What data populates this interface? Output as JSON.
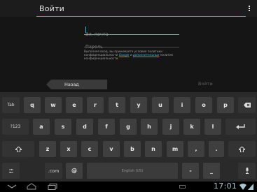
{
  "action_bar": {
    "title": "Войти"
  },
  "form": {
    "email_placeholder": "Эл. почта",
    "password_placeholder": "Пароль",
    "terms": {
      "part1": "Выполняя вход, вы принимаете условия политики конфиденциальности ",
      "link1": "Google",
      "part2": " и ",
      "link2": "дополнительных",
      "part3": " политик конфиденциальности."
    }
  },
  "nav": {
    "back_label": "Назад",
    "signin_label": "Войти"
  },
  "keyboard": {
    "row1": [
      "Tab",
      "q",
      "w",
      "e",
      "r",
      "t",
      "y",
      "u",
      "i",
      "o",
      "p"
    ],
    "row2": [
      "?123",
      "a",
      "s",
      "d",
      "f",
      "g",
      "h",
      "j",
      "k",
      "l"
    ],
    "row3": [
      "z",
      "x",
      "c",
      "v",
      "b",
      "n",
      "m",
      ",",
      "."
    ],
    "row4": [
      ".com",
      "@",
      "English (US)",
      "-",
      "_"
    ],
    "icons": {
      "backspace": "backspace-icon",
      "enter": "enter-icon",
      "shift": "shift-icon",
      "settings": "settings-icon",
      "mic": "mic-icon"
    }
  },
  "system_bar": {
    "clock": "17:01"
  },
  "colors": {
    "accent": "#33b5e5",
    "background": "#1a1a1a",
    "key": "#3f3f3f"
  }
}
